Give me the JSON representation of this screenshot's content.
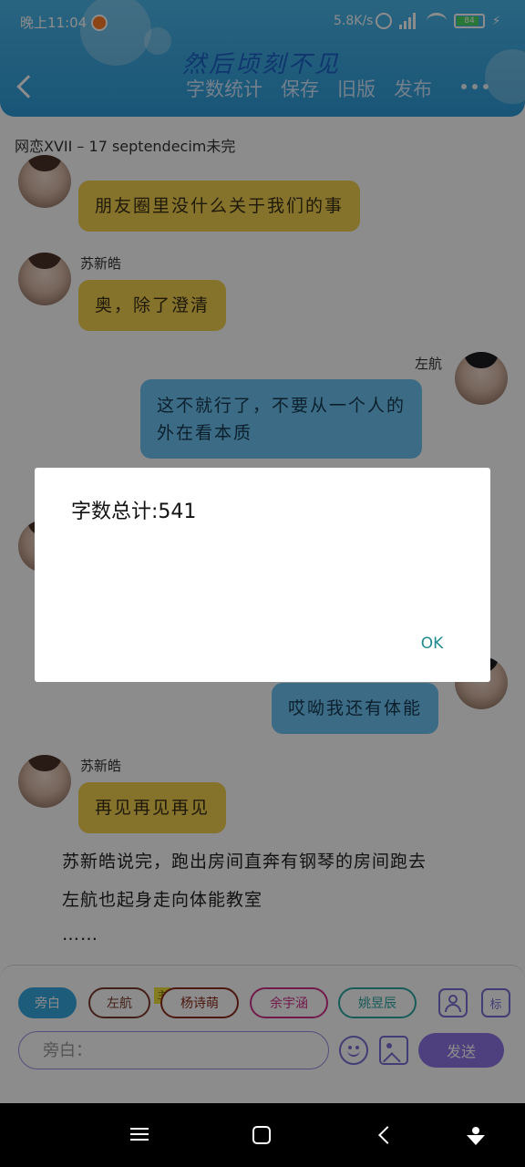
{
  "status_bar": {
    "time": "晚上11:04",
    "net_speed": "5.8K/s",
    "battery": "84"
  },
  "header": {
    "title": "然后顷刻不见",
    "toolbar": [
      "字数统计",
      "保存",
      "旧版",
      "发布"
    ]
  },
  "chapter_title": "网恋XVII – 17 septendecim未完",
  "messages": [
    {
      "sender": "",
      "side": "left",
      "text": "朋友圈里没什么关于我们的事"
    },
    {
      "sender": "苏新皓",
      "side": "left",
      "text": "奥，除了澄清"
    },
    {
      "sender": "左航",
      "side": "right",
      "text_lines": [
        "这不就行了，不要从一个人的",
        "外在看本质"
      ]
    },
    {
      "sender": "",
      "side": "right",
      "text": "哎呦我还有体能"
    },
    {
      "sender": "苏新皓",
      "side": "left",
      "text": "再见再见再见"
    }
  ],
  "narration": [
    "苏新皓说完，跑出房间直奔有钢琴的房间跑去",
    "左航也起身走向体能教室",
    "……"
  ],
  "roles": [
    {
      "label": "旁白",
      "active": true,
      "color": "#36a8e0"
    },
    {
      "label": "左航",
      "active": false,
      "color": "#7a3b2a"
    },
    {
      "label": "杨诗萌",
      "active": false,
      "color": "#8b2a1a"
    },
    {
      "label": "余宇涵",
      "active": false,
      "color": "#d0308a"
    },
    {
      "label": "姚昱辰",
      "active": false,
      "color": "#2aa7a0"
    }
  ],
  "main_tag": "主",
  "label_icon_text": "标",
  "input": {
    "placeholder": "旁白："
  },
  "send_label": "发送",
  "dialog": {
    "message": "字数总计:541",
    "ok_label": "OK"
  }
}
